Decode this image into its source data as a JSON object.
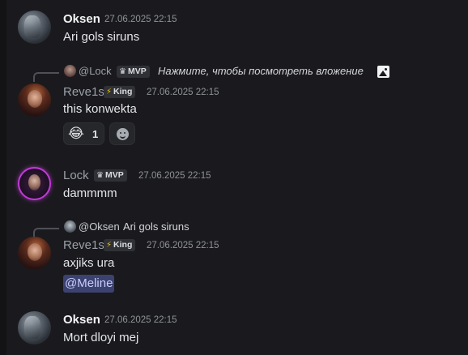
{
  "messages": [
    {
      "author": "Oksen",
      "timestamp": "27.06.2025 22:15",
      "text": "Ari gols siruns",
      "avatar": "oksen-avatar"
    },
    {
      "author": "Reve1s",
      "badge": "King",
      "timestamp": "27.06.2025 22:15",
      "text": "this konwekta",
      "reply": {
        "author": "@Lock",
        "author_badge": "MVP",
        "text": "Нажмите, чтобы посмотреть вложение"
      },
      "reactions": [
        {
          "emoji": "😂",
          "count": "1"
        }
      ]
    },
    {
      "author": "Lock",
      "badge": "MVP",
      "timestamp": "27.06.2025 22:15",
      "text": "dammmm"
    },
    {
      "author": "Reve1s",
      "badge": "King",
      "timestamp": "27.06.2025 22:15",
      "text": "axjiks ura",
      "mention": "@Meline",
      "reply": {
        "author": "@Oksen",
        "text": "Ari gols siruns"
      }
    },
    {
      "author": "Oksen",
      "timestamp": "27.06.2025 22:15",
      "text": "Mort dloyi mej"
    }
  ],
  "colors": {
    "background": "#1a1a1e",
    "mention_bg": "#3c4270",
    "lock_ring": "#c23ad9"
  }
}
